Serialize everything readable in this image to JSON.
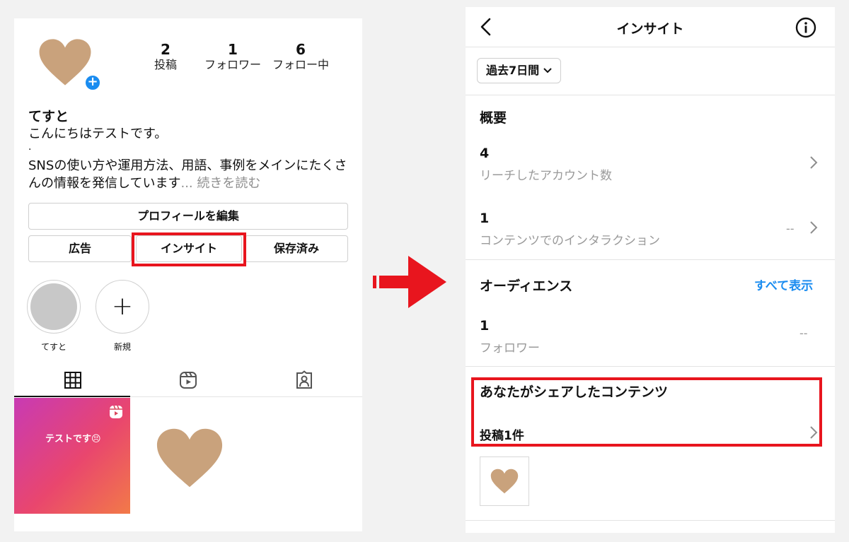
{
  "profile": {
    "stats": [
      {
        "num": "2",
        "label": "投稿"
      },
      {
        "num": "1",
        "label": "フォロワー"
      },
      {
        "num": "6",
        "label": "フォロー中"
      }
    ],
    "name": "てすと",
    "bio_line1": "こんにちはテストです。",
    "bio_dot": ".",
    "bio_line2": "SNSの使い方や運用方法、用語、事例をメインにたくさんの情報を発信しています",
    "bio_more": "... 続きを読む",
    "edit_button": "プロフィールを編集",
    "ad_button": "広告",
    "insight_button": "インサイト",
    "saved_button": "保存済み",
    "stories": [
      {
        "label": "てすと"
      },
      {
        "label": "新規"
      }
    ],
    "post_text": "テストです😣"
  },
  "insights": {
    "title": "インサイト",
    "period": "過去7日間",
    "overview_title": "概要",
    "reach_num": "4",
    "reach_label": "リーチしたアカウント数",
    "interaction_num": "1",
    "interaction_label": "コンテンツでのインタラクション",
    "interaction_dash": "--",
    "audience_title": "オーディエンス",
    "see_all": "すべて表示",
    "followers_num": "1",
    "followers_label": "フォロワー",
    "followers_dash": "--",
    "shared_title": "あなたがシェアしたコンテンツ",
    "shared_count": "投稿1件"
  },
  "colors": {
    "accent_blue": "#1a8cf0",
    "highlight_red": "#e8151e",
    "heart": "#c9a27c"
  }
}
